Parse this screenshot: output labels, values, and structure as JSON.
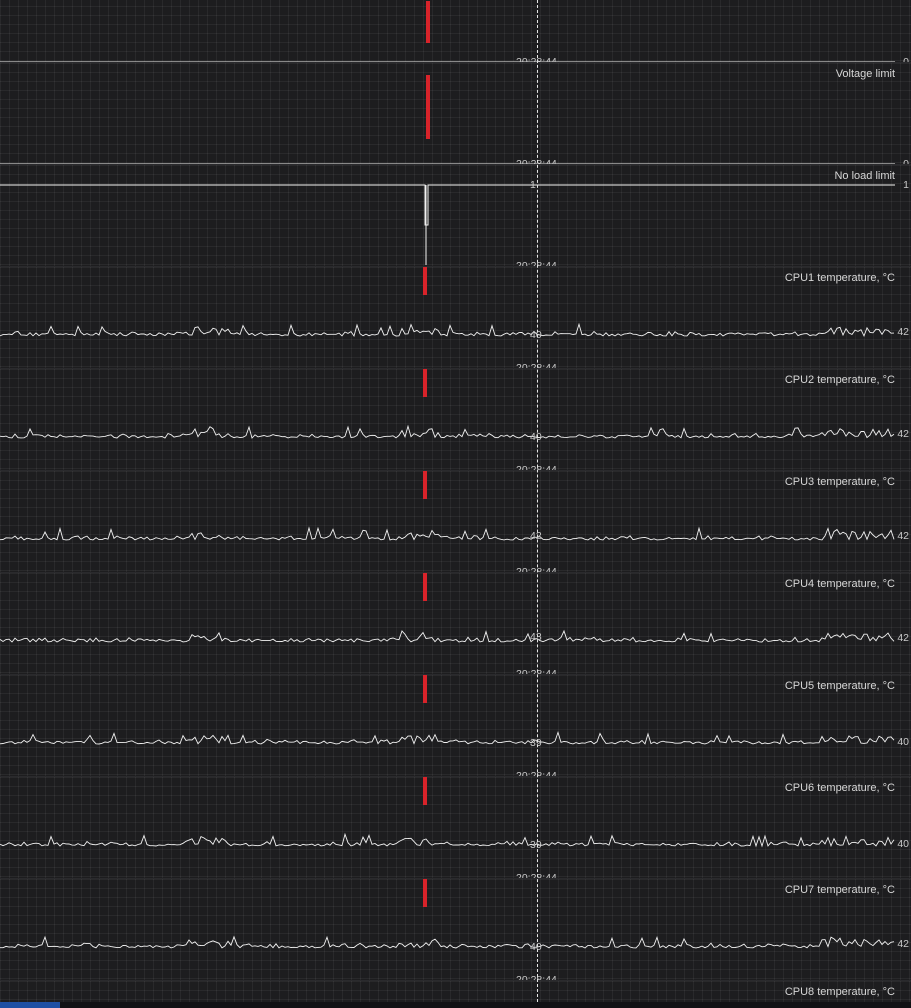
{
  "timestamp": "20:28:44",
  "colors": {
    "background": "#1d1d1f",
    "trace": "#f2f2f2",
    "marker": "#d8232a",
    "text": "#d6d6d6"
  },
  "graphs": [
    {
      "id": "top",
      "title": "",
      "time": "20:28:44",
      "current": "",
      "end": "0",
      "kind": "flat0"
    },
    {
      "id": "voltage-limit",
      "title": "Voltage limit",
      "time": "20:28:44",
      "current": "",
      "end": "0",
      "kind": "flat0"
    },
    {
      "id": "no-load-limit",
      "title": "No load limit",
      "time": "20:28:44",
      "current": "1",
      "end": "1",
      "kind": "flat1"
    },
    {
      "id": "cpu1-temp",
      "title": "CPU1 temperature, °C",
      "time": "20:28:44",
      "current": "40",
      "end": "42",
      "kind": "temp"
    },
    {
      "id": "cpu2-temp",
      "title": "CPU2 temperature, °C",
      "time": "20:28:44",
      "current": "40",
      "end": "42",
      "kind": "temp"
    },
    {
      "id": "cpu3-temp",
      "title": "CPU3 temperature, °C",
      "time": "20:28:44",
      "current": "42",
      "end": "42",
      "kind": "temp"
    },
    {
      "id": "cpu4-temp",
      "title": "CPU4 temperature, °C",
      "time": "20:28:44",
      "current": "43",
      "end": "42",
      "kind": "temp"
    },
    {
      "id": "cpu5-temp",
      "title": "CPU5 temperature, °C",
      "time": "20:28:44",
      "current": "39",
      "end": "40",
      "kind": "temp"
    },
    {
      "id": "cpu6-temp",
      "title": "CPU6 temperature, °C",
      "time": "20:28:44",
      "current": "39",
      "end": "40",
      "kind": "temp"
    },
    {
      "id": "cpu7-temp",
      "title": "CPU7 temperature, °C",
      "time": "20:28:44",
      "current": "40",
      "end": "42",
      "kind": "temp"
    }
  ],
  "footer_title": "CPU8 temperature, °C"
}
